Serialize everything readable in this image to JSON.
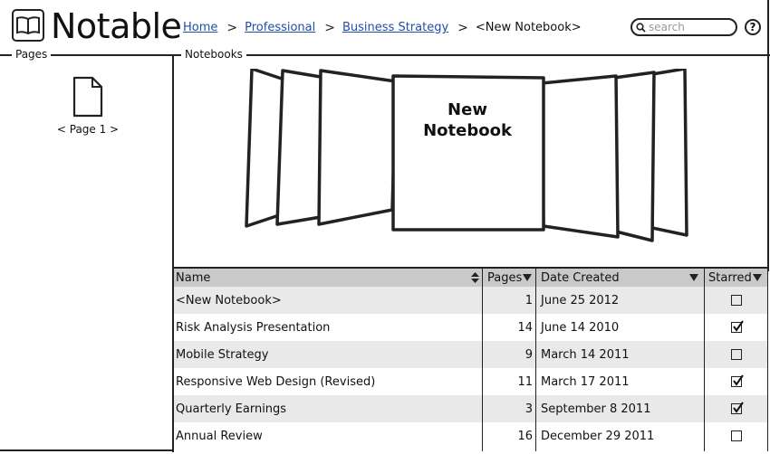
{
  "app": {
    "title": "Notable"
  },
  "breadcrumb": {
    "items": [
      "Home",
      "Professional",
      "Business Strategy"
    ],
    "separator": ">",
    "current": "<New Notebook>"
  },
  "search": {
    "placeholder": "search"
  },
  "help": {
    "label": "?"
  },
  "pages_panel": {
    "label": "Pages",
    "pages": [
      {
        "caption": "< Page 1 >"
      }
    ]
  },
  "notebooks_panel": {
    "label": "Notebooks",
    "selected_notebook": {
      "line1": "New",
      "line2": "Notebook"
    }
  },
  "table": {
    "columns": {
      "name": "Name",
      "pages": "Pages",
      "date": "Date Created",
      "starred": "Starred"
    },
    "rows": [
      {
        "name": "<New Notebook>",
        "pages": "1",
        "date": "June 25 2012",
        "starred": false
      },
      {
        "name": "Risk Analysis Presentation",
        "pages": "14",
        "date": "June 14 2010",
        "starred": true
      },
      {
        "name": "Mobile Strategy",
        "pages": "9",
        "date": "March 14 2011",
        "starred": false
      },
      {
        "name": "Responsive Web Design (Revised)",
        "pages": "11",
        "date": "March 17 2011",
        "starred": true
      },
      {
        "name": "Quarterly Earnings",
        "pages": "3",
        "date": "September 8 2011",
        "starred": true
      },
      {
        "name": "Annual Review",
        "pages": "16",
        "date": "December 29 2011",
        "starred": false
      }
    ]
  }
}
